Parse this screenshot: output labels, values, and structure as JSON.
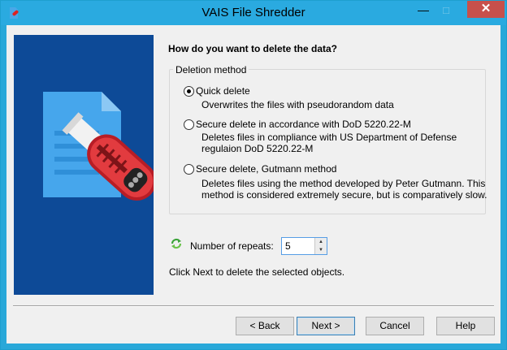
{
  "window": {
    "title": "VAIS File Shredder",
    "minimize_glyph": "—",
    "maximize_glyph": "□",
    "close_glyph": "✕",
    "accent_color": "#2aaae0"
  },
  "side_panel": {
    "illustration": "document-shredder-icon",
    "background_color": "#0d4a97"
  },
  "main": {
    "question": "How do you want to delete the data?",
    "group_title": "Deletion method",
    "options": [
      {
        "label": "Quick delete",
        "checked": true,
        "description": [
          "Overwrites the files with pseudorandom data"
        ]
      },
      {
        "label": "Secure delete in accordance with DoD 5220.22-M",
        "checked": false,
        "description": [
          "Deletes files in compliance with US Department of Defense",
          "regulaion DoD 5220.22-M"
        ]
      },
      {
        "label": "Secure delete, Gutmann method",
        "checked": false,
        "description": [
          "Deletes files using the method developed by Peter Gutmann. This",
          "method is considered extremely secure, but is comparatively slow."
        ]
      }
    ],
    "repeats": {
      "icon": "refresh-icon",
      "label": "Number of repeats:",
      "value": "5"
    },
    "hint": "Click Next to delete the selected objects."
  },
  "buttons": {
    "back": "< Back",
    "next": "Next >",
    "cancel": "Cancel",
    "help": "Help"
  }
}
